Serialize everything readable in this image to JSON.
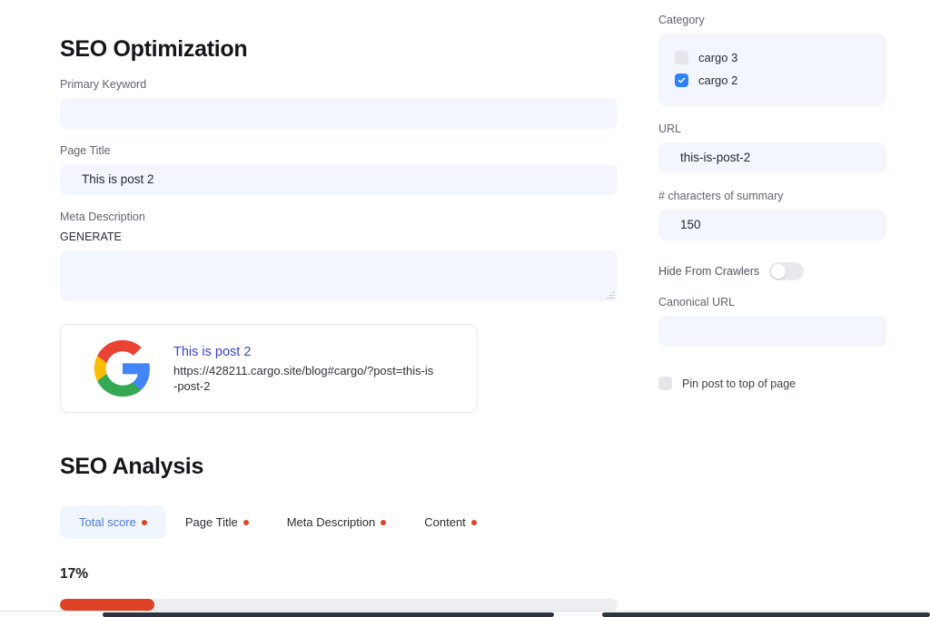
{
  "main": {
    "seo_optimization_title": "SEO Optimization",
    "primary_keyword": {
      "label": "Primary Keyword",
      "value": "",
      "placeholder": ""
    },
    "page_title": {
      "label": "Page Title",
      "value": "This is post 2",
      "placeholder": ""
    },
    "meta_description": {
      "label": "Meta Description",
      "action_label": "GENERATE",
      "value": "",
      "placeholder": ""
    },
    "google_preview": {
      "icon": "google-logo-icon",
      "title": "This is post 2",
      "url": "https://428211.cargo.site/blog#cargo/?post=this-is-post-2"
    },
    "seo_analysis_title": "SEO Analysis",
    "tabs": [
      {
        "label": "Total score",
        "active": true,
        "status_color": "#e04326"
      },
      {
        "label": "Page Title",
        "active": false,
        "status_color": "#e04326"
      },
      {
        "label": "Meta Description",
        "active": false,
        "status_color": "#e04326"
      },
      {
        "label": "Content",
        "active": false,
        "status_color": "#e04326"
      }
    ],
    "score": {
      "percent_label": "17%",
      "percent_value": 17,
      "bar_color": "#dd4226"
    }
  },
  "sidebar": {
    "category": {
      "label": "Category",
      "options": [
        {
          "label": "cargo 3",
          "checked": false
        },
        {
          "label": "cargo 2",
          "checked": true
        }
      ]
    },
    "url": {
      "label": "URL",
      "value": "this-is-post-2",
      "placeholder": ""
    },
    "summary_chars": {
      "label": "# characters of summary",
      "value": "150",
      "placeholder": ""
    },
    "hide_from_crawlers": {
      "label": "Hide From Crawlers",
      "enabled": false
    },
    "canonical_url": {
      "label": "Canonical URL",
      "value": "",
      "placeholder": ""
    },
    "pin_post": {
      "label": "Pin post to top of page",
      "checked": false
    }
  },
  "colors": {
    "accent_blue": "#4c79ef",
    "checkbox_blue": "#2e82fd",
    "link_indigo": "#3b41cf",
    "status_red": "#e04326",
    "field_bg": "#f3f6fd"
  }
}
